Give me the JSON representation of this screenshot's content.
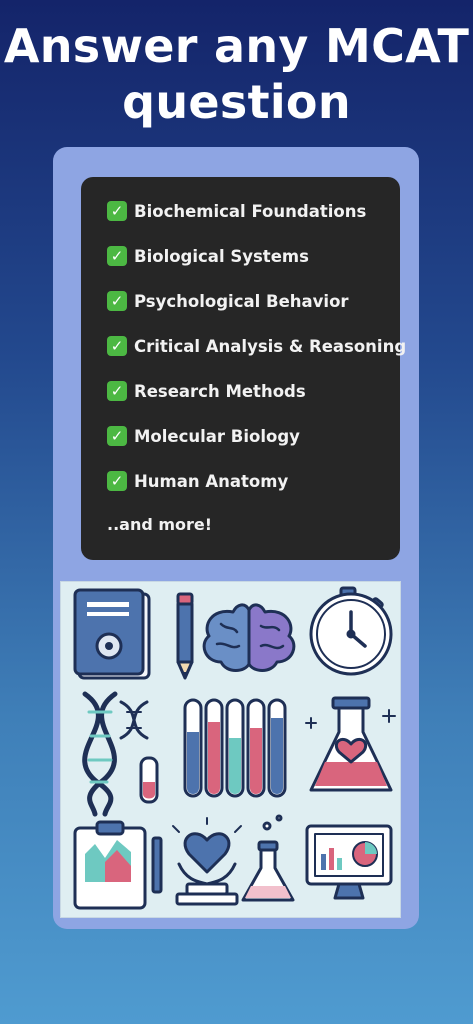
{
  "headline": "Answer any MCAT question",
  "topics": [
    "Biochemical Foundations",
    "Biological Systems",
    "Psychological Behavior",
    "Critical Analysis & Reasoning",
    "Research Methods",
    "Molecular Biology",
    "Human Anatomy"
  ],
  "more_text": "..and more!",
  "check_glyph": "✓",
  "colors": {
    "card": "#8ea5e3",
    "list_background": "#262626",
    "check": "#4cb843",
    "icon_outline": "#1e2f55",
    "icon_blue": "#5b7fb4",
    "icon_pink": "#d9657d",
    "icon_teal": "#6ec9c1"
  },
  "icons": [
    "book-icon",
    "pencil-icon",
    "brain-icon",
    "stopwatch-icon",
    "dna-icon",
    "test-tubes-icon",
    "flask-heart-icon",
    "clipboard-chart-icon",
    "heart-hands-icon",
    "beaker-icon",
    "monitor-chart-icon"
  ]
}
